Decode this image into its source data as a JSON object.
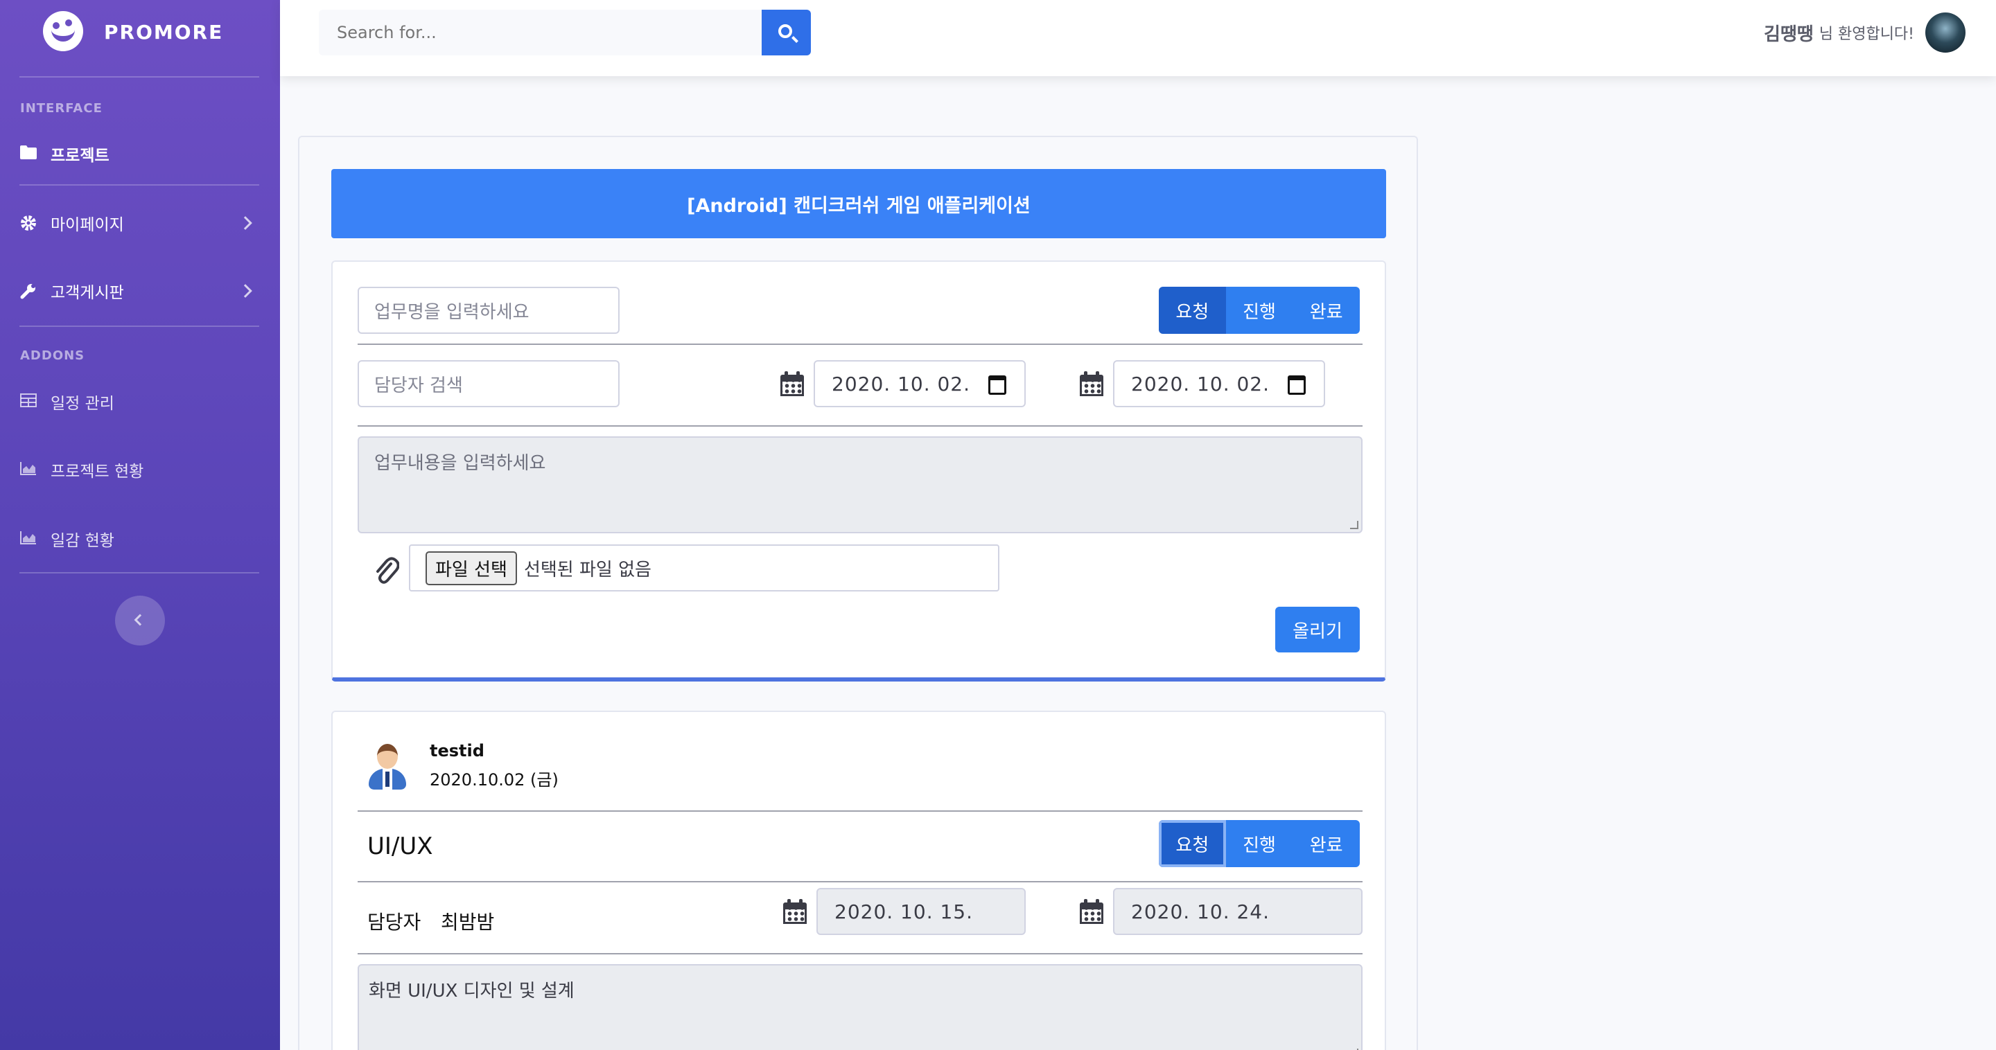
{
  "brand": {
    "name": "PROMORE"
  },
  "sidebar": {
    "heading_interface": "INTERFACE",
    "heading_addons": "ADDONS",
    "items": [
      {
        "label": "프로젝트",
        "icon": "folder-icon"
      },
      {
        "label": "마이페이지",
        "icon": "gear-icon"
      },
      {
        "label": "고객게시판",
        "icon": "wrench-icon"
      },
      {
        "label": "일정 관리",
        "icon": "table-icon"
      },
      {
        "label": "프로젝트 현황",
        "icon": "area-chart-icon"
      },
      {
        "label": "일감 현황",
        "icon": "area-chart-icon"
      }
    ]
  },
  "topbar": {
    "search_placeholder": "Search for...",
    "user_name": "김땡땡",
    "welcome": "님 환영합니다!"
  },
  "project": {
    "title": "[Android] 캔디크러쉬 게임 애플리케이션"
  },
  "form": {
    "task_placeholder": "업무명을 입력하세요",
    "assignee_placeholder": "담당자 검색",
    "start_date": "2020. 10. 02.",
    "end_date": "2020. 10. 02.",
    "content_placeholder": "업무내용을 입력하세요",
    "file_button": "파일 선택",
    "file_status": "선택된 파일 없음",
    "submit": "올리기",
    "status": [
      "요청",
      "진행",
      "완료"
    ]
  },
  "post": {
    "author": "testid",
    "date": "2020.10.02 (금)",
    "title": "UI/UX",
    "assignee_label": "담당자",
    "assignee": "최밤밤",
    "start_date": "2020. 10. 15.",
    "end_date": "2020. 10. 24.",
    "content": "화면 UI/UX 디자인 및 설계",
    "status": [
      "요청",
      "진행",
      "완료"
    ]
  },
  "colors": {
    "primary": "#2f7ff0",
    "sidebar_top": "#6d4fc4",
    "sidebar_bottom": "#4439a6",
    "title_bar": "#3a82f7"
  }
}
